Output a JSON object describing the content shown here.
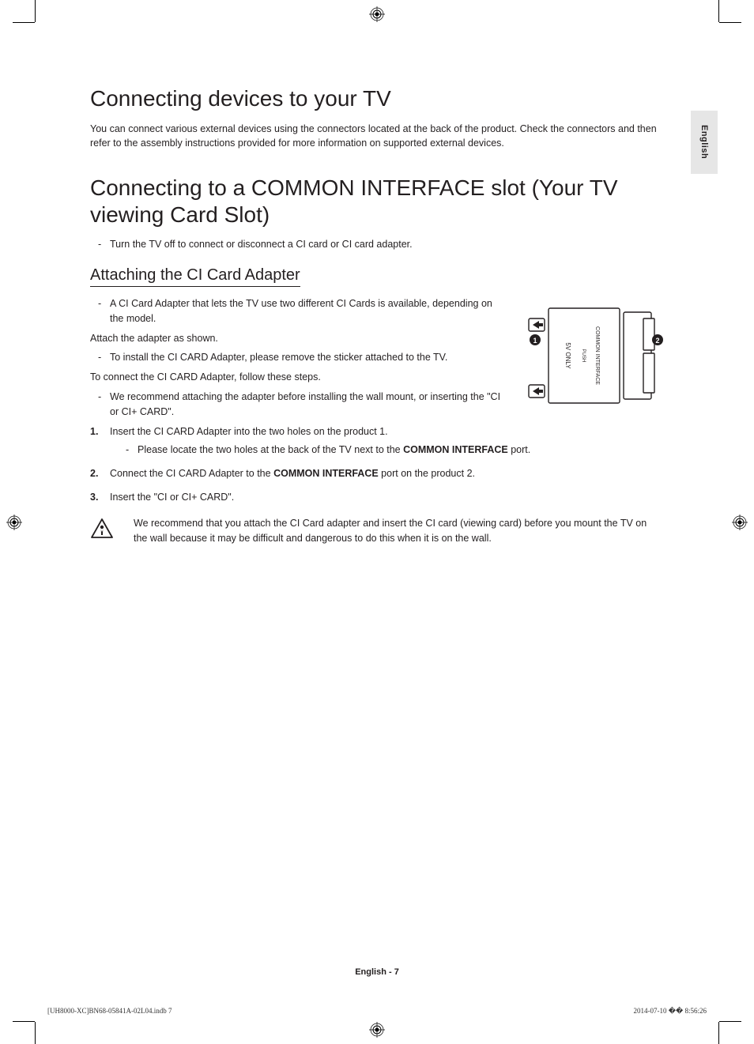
{
  "language_tab": "English",
  "heading1": "Connecting devices to your TV",
  "intro": "You can connect various external devices using the connectors located at the back of the product. Check the connectors and then refer to the assembly instructions provided for more information on supported external devices.",
  "heading2": "Connecting to a COMMON INTERFACE slot (Your TV viewing Card Slot)",
  "bullet_turnoff": "Turn the TV off to connect or disconnect a CI card or CI card adapter.",
  "subheading": "Attaching the CI Card Adapter",
  "bullet_adapter_avail": "A CI Card Adapter that lets the TV use two different CI Cards is available, depending on the model.",
  "para_attach": "Attach the adapter as shown.",
  "bullet_remove_sticker": "To install the CI CARD Adapter, please remove the sticker attached to the TV.",
  "para_connect": "To connect the CI CARD Adapter, follow these steps.",
  "bullet_recommend": "We recommend attaching the adapter before installing the wall mount, or inserting the \"CI or CI+ CARD\".",
  "step1_num": "1.",
  "step1_pre": "Insert the CI CARD Adapter into the two holes on the product 1.",
  "step1_nested_pre": "Please locate the two holes at the back of the TV next to the ",
  "step1_nested_bold": "COMMON INTERFACE",
  "step1_nested_post": " port.",
  "step2_num": "2.",
  "step2_pre": "Connect the CI CARD Adapter to the ",
  "step2_bold": "COMMON INTERFACE",
  "step2_post": " port on the product 2.",
  "step3_num": "3.",
  "step3_text": "Insert the \"CI or CI+ CARD\".",
  "warn_text": "We recommend that you attach the CI Card adapter and insert the CI card (viewing card) before you mount the TV on the wall because it may be difficult and dangerous to do this when it is on the wall.",
  "diagram": {
    "label_5v": "5V ONLY",
    "label_push": "PUSH",
    "label_common": "COMMON INTERFACE",
    "num1": "1",
    "num2": "2"
  },
  "footer": "English - 7",
  "print_left": "[UH8000-XC]BN68-05841A-02L04.indb   7",
  "print_right": "2014-07-10   �� 8:56:26"
}
